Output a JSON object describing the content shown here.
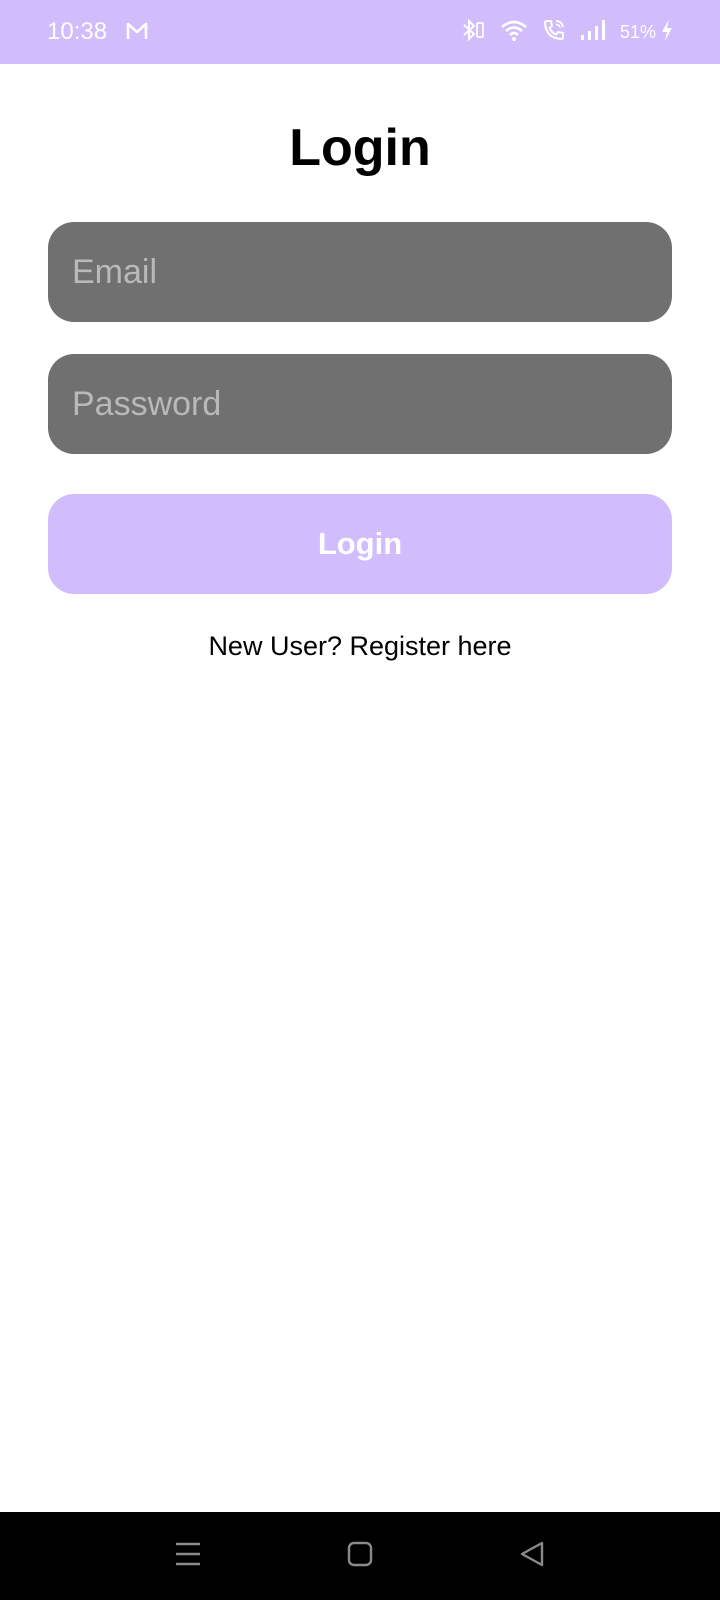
{
  "status_bar": {
    "time": "10:38",
    "battery_percent": "51%",
    "background": "#d1bcfc",
    "icons": [
      "gmail-icon",
      "bluetooth-icon",
      "wifi-icon",
      "wifi-calling-icon",
      "signal-icon",
      "charging-icon"
    ]
  },
  "page": {
    "title": "Login"
  },
  "form": {
    "email_placeholder": "Email",
    "email_value": "",
    "password_placeholder": "Password",
    "password_value": "",
    "field_background": "#707070",
    "login_label": "Login",
    "login_background": "#d1bcfc",
    "register_text": "New User? Register here"
  },
  "nav_bar": {
    "buttons": [
      "menu-icon",
      "home-icon",
      "back-icon"
    ]
  }
}
